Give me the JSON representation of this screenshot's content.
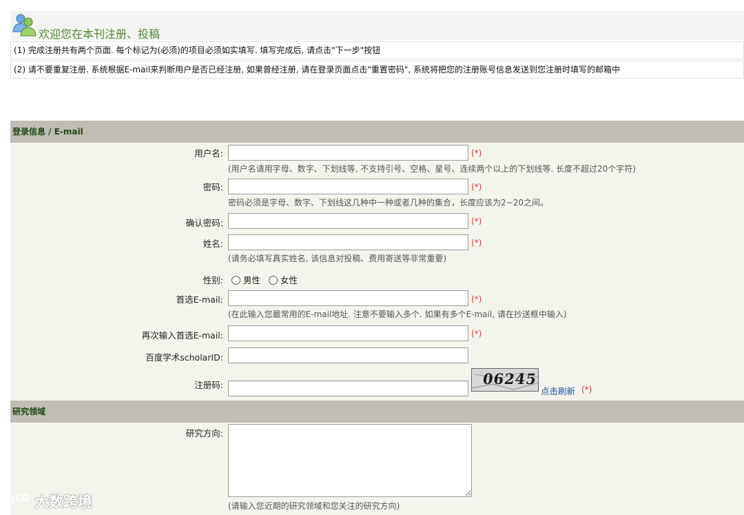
{
  "header": {
    "title": "欢迎您在本刊注册、投稿",
    "notices": [
      "(1) 完成注册共有两个页面. 每个标记为(必须)的项目必须如实填写. 填写完成后, 请点击\"下一步\"按钮",
      "(2) 请不要重复注册. 系统根据E-mail来判断用户是否已经注册, 如果曾经注册, 请在登录页面点击\"重置密码\", 系统将把您的注册账号信息发送到您注册时填写的邮箱中"
    ]
  },
  "sections": {
    "login": "登录信息 / E-mail",
    "research": "研究领域"
  },
  "required_mark": "(*)",
  "fields": {
    "username": {
      "label": "用户名:",
      "value": "",
      "hint": "(用户名请用字母、数字、下划线等, 不支持引号、空格、星号、连续两个以上的下划线等. 长度不超过20个字符)"
    },
    "password": {
      "label": "密码:",
      "value": "",
      "hint": "密码必须是字母、数字、下划线这几种中一种或者几种的集合，长度应该为2~20之间。"
    },
    "confirm_password": {
      "label": "确认密码:",
      "value": ""
    },
    "name": {
      "label": "姓名:",
      "value": "",
      "hint": "(请务必填写真实姓名, 该信息对投稿、费用寄送等非常重要)"
    },
    "gender": {
      "label": "性别:",
      "options": [
        "男性",
        "女性"
      ]
    },
    "email": {
      "label": "首选E-mail:",
      "value": "",
      "hint": "(在此输入您最常用的E-mail地址. 注意不要输入多个. 如果有多个E-mail, 请在抄送框中输入)"
    },
    "email_confirm": {
      "label": "再次输入首选E-mail:",
      "value": ""
    },
    "scholar_id": {
      "label": "百度学术scholarID:",
      "value": ""
    },
    "reg_code": {
      "label": "注册码:",
      "value": "",
      "captcha": "06245",
      "refresh": "点击刷新"
    },
    "research_direction": {
      "label": "研究方向:",
      "value": "",
      "hint": "(请输入您近期的研究领域和您关注的研究方向)"
    }
  },
  "watermark": "大数跨境",
  "colors": {
    "accent_green": "#4f8a2c",
    "section_bg": "#bfbdb4",
    "required_red": "#e53535",
    "link_blue": "#1a4f9c"
  }
}
